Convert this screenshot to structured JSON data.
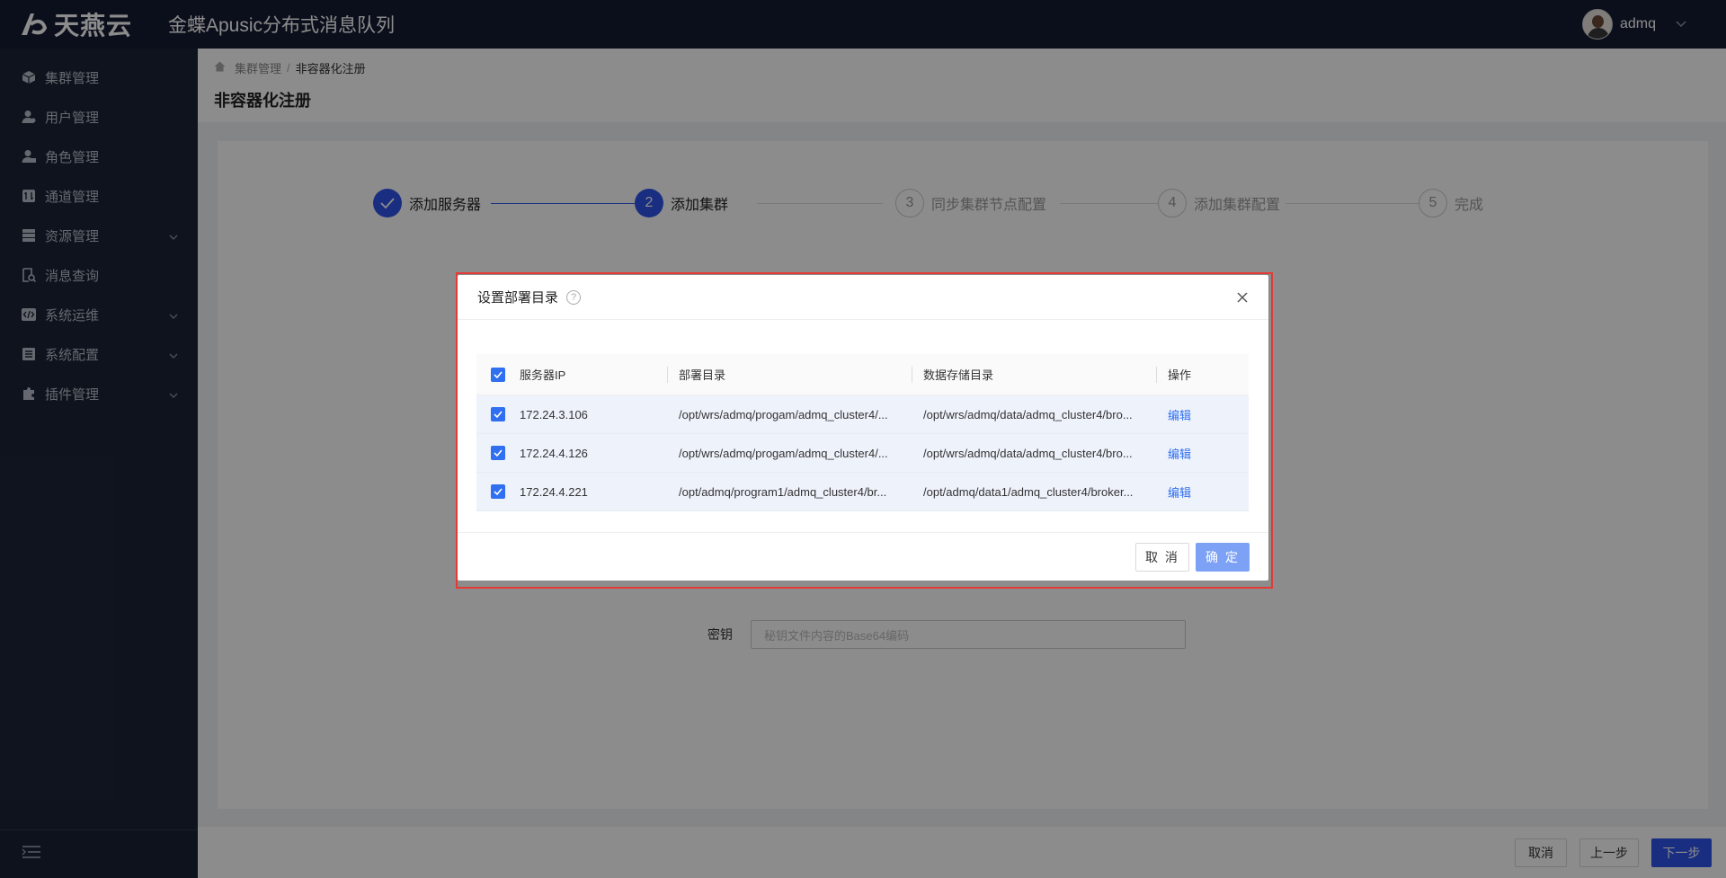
{
  "header": {
    "logo_text": "天燕云",
    "app_title": "金蝶Apusic分布式消息队列",
    "username": "admq"
  },
  "sidebar": {
    "items": [
      {
        "label": "集群管理",
        "icon": "cube-icon",
        "expandable": false
      },
      {
        "label": "用户管理",
        "icon": "user-icon",
        "expandable": false
      },
      {
        "label": "角色管理",
        "icon": "role-icon",
        "expandable": false
      },
      {
        "label": "通道管理",
        "icon": "channel-icon",
        "expandable": false
      },
      {
        "label": "资源管理",
        "icon": "server-icon",
        "expandable": true
      },
      {
        "label": "消息查询",
        "icon": "search-doc-icon",
        "expandable": false
      },
      {
        "label": "系统运维",
        "icon": "code-icon",
        "expandable": true
      },
      {
        "label": "系统配置",
        "icon": "list-icon",
        "expandable": true
      },
      {
        "label": "插件管理",
        "icon": "puzzle-icon",
        "expandable": true
      }
    ]
  },
  "breadcrumb": {
    "items": [
      "集群管理",
      "非容器化注册"
    ]
  },
  "page_title": "非容器化注册",
  "steps": [
    {
      "number": "1",
      "label": "添加服务器",
      "status": "done"
    },
    {
      "number": "2",
      "label": "添加集群",
      "status": "active"
    },
    {
      "number": "3",
      "label": "同步集群节点配置",
      "status": "wait"
    },
    {
      "number": "4",
      "label": "添加集群配置",
      "status": "wait"
    },
    {
      "number": "5",
      "label": "完成",
      "status": "wait"
    }
  ],
  "form": {
    "secret_label": "密钥",
    "secret_placeholder": "秘钥文件内容的Base64编码"
  },
  "footer": {
    "cancel": "取消",
    "prev": "上一步",
    "next": "下一步"
  },
  "modal": {
    "title": "设置部署目录",
    "columns": [
      "服务器IP",
      "部署目录",
      "数据存储目录",
      "操作"
    ],
    "rows": [
      {
        "ip": "172.24.3.106",
        "deploy_dir": "/opt/wrs/admq/progam/admq_cluster4/...",
        "data_dir": "/opt/wrs/admq/data/admq_cluster4/bro...",
        "action": "编辑",
        "checked": true
      },
      {
        "ip": "172.24.4.126",
        "deploy_dir": "/opt/wrs/admq/progam/admq_cluster4/...",
        "data_dir": "/opt/wrs/admq/data/admq_cluster4/bro...",
        "action": "编辑",
        "checked": true
      },
      {
        "ip": "172.24.4.221",
        "deploy_dir": "/opt/admq/program1/admq_cluster4/br...",
        "data_dir": "/opt/admq/data1/admq_cluster4/broker...",
        "action": "编辑",
        "checked": true
      }
    ],
    "cancel": "取 消",
    "confirm": "确 定"
  },
  "colors": {
    "primary": "#2f54eb",
    "link": "#2f6ff0",
    "topbar": "#141d33",
    "sidebar": "#1b2438",
    "highlight_border": "#e53935"
  }
}
